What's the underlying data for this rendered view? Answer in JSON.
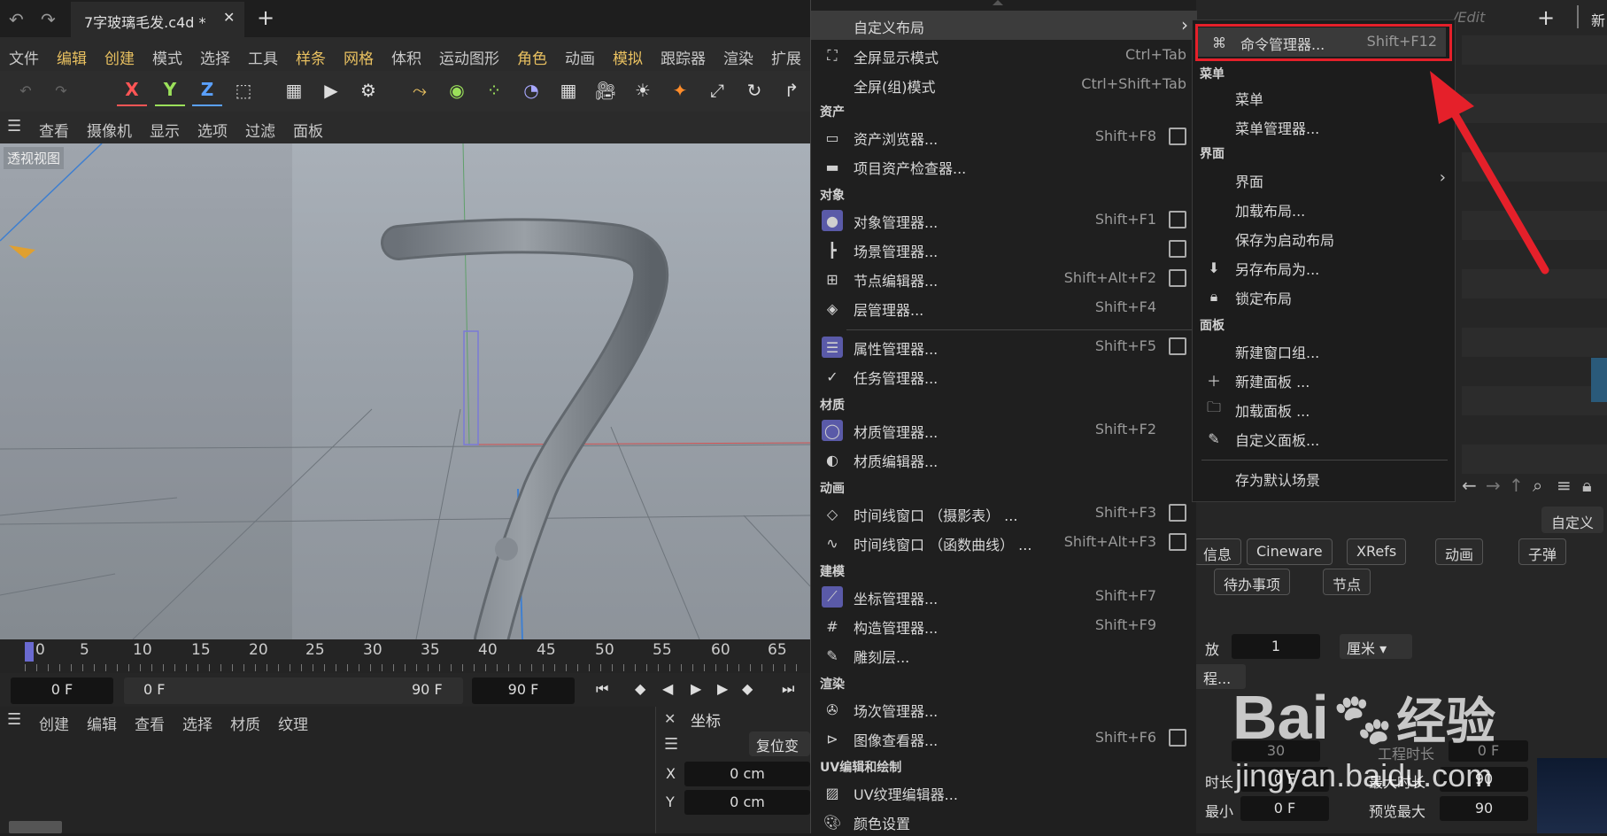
{
  "window": {
    "tab_title": "7字玻璃毛发.c4d *",
    "new_tab": "+"
  },
  "menubar": [
    "文件",
    "编辑",
    "创建",
    "模式",
    "选择",
    "工具",
    "样条",
    "网格",
    "体积",
    "运动图形",
    "角色",
    "动画",
    "模拟",
    "跟踪器",
    "渲染",
    "扩展"
  ],
  "axis_buttons": {
    "x": "X",
    "y": "Y",
    "z": "Z"
  },
  "viewbar": [
    "查看",
    "摄像机",
    "显示",
    "选项",
    "过滤",
    "面板"
  ],
  "viewport": {
    "label": "透视视图"
  },
  "timeline": {
    "ticks": [
      "0",
      "5",
      "10",
      "15",
      "20",
      "25",
      "30",
      "35",
      "40",
      "45",
      "50",
      "55",
      "60",
      "65"
    ]
  },
  "transport": {
    "current": "0 F",
    "start": "0 F",
    "end": "90 F",
    "end2": "90 F"
  },
  "bottom_menu": [
    "创建",
    "编辑",
    "查看",
    "选择",
    "材质",
    "纹理"
  ],
  "coords": {
    "title": "坐标",
    "reset": "复位变",
    "x_label": "X",
    "x_value": "0 cm",
    "y_label": "Y",
    "y_value": "0 cm"
  },
  "menu": {
    "top": {
      "label": "自定义布局",
      "arrow": "›"
    },
    "items_top": [
      {
        "label": "全屏显示模式",
        "shortcut": "Ctrl+Tab"
      },
      {
        "label": "全屏(组)模式",
        "shortcut": "Ctrl+Shift+Tab"
      }
    ],
    "sections": {
      "asset": "资产",
      "object": "对象",
      "material": "材质",
      "animation": "动画",
      "modeling": "建模",
      "render": "渲染",
      "uv": "UV编辑和绘制"
    },
    "asset": [
      {
        "label": "资产浏览器...",
        "shortcut": "Shift+F8"
      },
      {
        "label": "项目资产检查器...",
        "shortcut": ""
      }
    ],
    "object": [
      {
        "label": "对象管理器...",
        "shortcut": "Shift+F1"
      },
      {
        "label": "场景管理器...",
        "shortcut": ""
      },
      {
        "label": "节点编辑器...",
        "shortcut": "Shift+Alt+F2"
      },
      {
        "label": "层管理器...",
        "shortcut": "Shift+F4"
      },
      {
        "label": "属性管理器...",
        "shortcut": "Shift+F5"
      },
      {
        "label": "任务管理器...",
        "shortcut": ""
      }
    ],
    "material": [
      {
        "label": "材质管理器...",
        "shortcut": "Shift+F2"
      },
      {
        "label": "材质编辑器...",
        "shortcut": ""
      }
    ],
    "animation": [
      {
        "label": "时间线窗口 （摄影表） ...",
        "shortcut": "Shift+F3"
      },
      {
        "label": "时间线窗口 （函数曲线） ...",
        "shortcut": "Shift+Alt+F3"
      }
    ],
    "modeling": [
      {
        "label": "坐标管理器...",
        "shortcut": "Shift+F7"
      },
      {
        "label": "构造管理器...",
        "shortcut": "Shift+F9"
      },
      {
        "label": "雕刻层...",
        "shortcut": ""
      }
    ],
    "render": [
      {
        "label": "场次管理器...",
        "shortcut": ""
      },
      {
        "label": "图像查看器...",
        "shortcut": "Shift+F6"
      }
    ],
    "uv": [
      {
        "label": "UV纹理编辑器...",
        "shortcut": ""
      },
      {
        "label": "颜色设置",
        "shortcut": ""
      }
    ]
  },
  "submenu": {
    "command": {
      "label": "命令管理器...",
      "shortcut": "Shift+F12"
    },
    "sec_menu": "菜单",
    "menu_items": [
      "菜单",
      "菜单管理器..."
    ],
    "sec_ui": "界面",
    "ui_items": [
      "界面",
      "加载布局...",
      "保存为启动布局",
      "另存布局为...",
      "锁定布局"
    ],
    "sec_panel": "面板",
    "panel_items": [
      "新建窗口组...",
      "新建面板 ...",
      "加载面板 ...",
      "自定义面板..."
    ],
    "save_default": "存为默认场景"
  },
  "right": {
    "edit": "/Edit",
    "plus": "+",
    "new": "新",
    "custom": "自定义",
    "chips": [
      "信息",
      "Cineware",
      "XRefs",
      "动画",
      "子弹",
      "待办事项",
      "节点"
    ],
    "fps_label": "放",
    "fps_value": "1",
    "unit": "厘米",
    "proj": "程...",
    "row1": [
      "30",
      "工程时长",
      "0 F"
    ],
    "row2_label": "时长",
    "row2_val": "0 F",
    "row2_b": "最大时长",
    "row2_c": "90",
    "row3_label": "最小",
    "row3_val": "0 F",
    "row3_b": "预览最大",
    "row3_c": "90"
  },
  "watermark": {
    "brand": "Bai",
    "brand2": "经验",
    "url": "jingyan.baidu.com"
  },
  "colors": {
    "highlight_box": "#e5202a",
    "arrow": "#e5202a",
    "accent": "#7a7ad6"
  }
}
